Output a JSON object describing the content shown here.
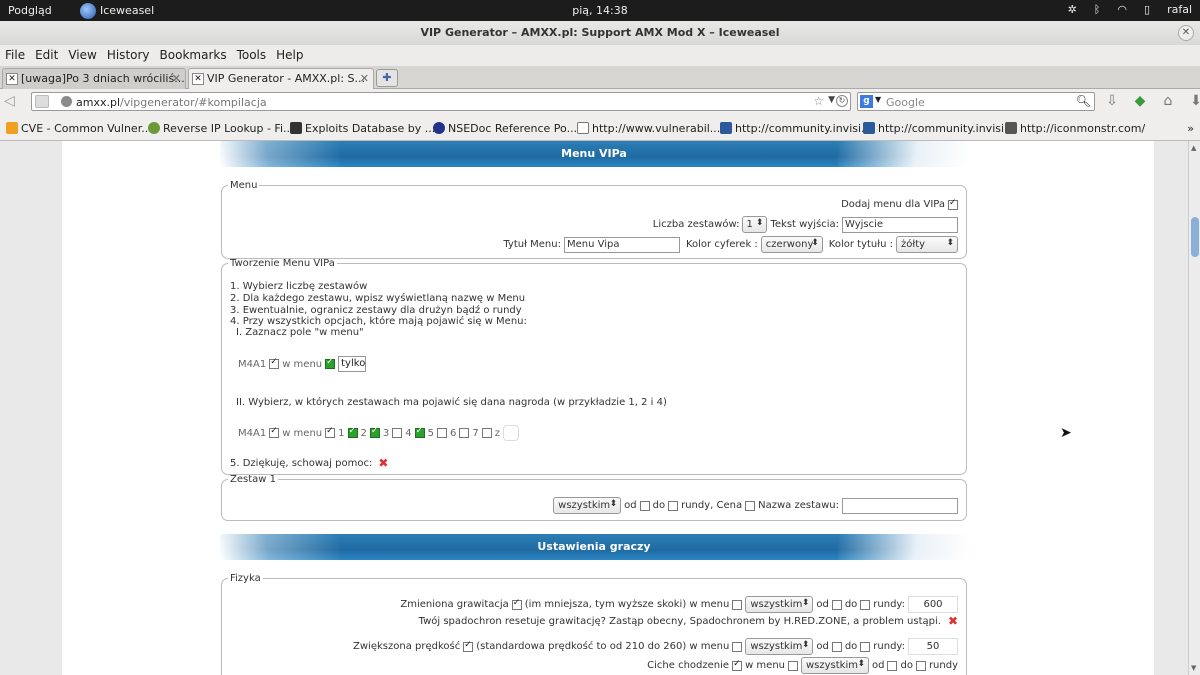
{
  "topbar": {
    "activities": "Podgląd",
    "app": "Iceweasel",
    "clock": "pią, 14:38",
    "user": "rafal"
  },
  "window": {
    "title": "VIP Generator – AMXX.pl: Support AMX Mod X – Iceweasel"
  },
  "menu": [
    "File",
    "Edit",
    "View",
    "History",
    "Bookmarks",
    "Tools",
    "Help"
  ],
  "tabs": [
    {
      "label": "[uwaga]Po 3 dniach wróciliś..."
    },
    {
      "label": "VIP Generator - AMXX.pl: S..."
    }
  ],
  "nav": {
    "url_host": "amxx.pl",
    "url_rest": "/vipgenerator/#kompilacja",
    "search_placeholder": "Google"
  },
  "bookmarks": [
    {
      "label": "CVE - Common Vulner...",
      "color": "#f0a020"
    },
    {
      "label": "Reverse IP Lookup - Fi...",
      "color": "#6a9a3a"
    },
    {
      "label": "Exploits Database by ...",
      "color": "#333333"
    },
    {
      "label": "NSEDoc Reference Po...",
      "color": "#223388"
    },
    {
      "label": "http://www.vulnerabil...",
      "color": "#ffffff"
    },
    {
      "label": "http://community.invisi...",
      "color": "#2a5a9a"
    },
    {
      "label": "http://community.invisi...",
      "color": "#2a5a9a"
    },
    {
      "label": "http://iconmonstr.com/",
      "color": "#555555"
    }
  ],
  "menu_vipa": {
    "header": "Menu VIPa",
    "menu_legend": "Menu",
    "add_menu_label": "Dodaj menu dla VIPa",
    "sets_count_label": "Liczba zestawów:",
    "sets_count_value": "1",
    "exit_text_label": "Tekst wyjścia:",
    "exit_text_value": "Wyjscie",
    "menu_title_label": "Tytuł Menu:",
    "menu_title_value": "Menu Vipa",
    "digit_color_label": "Kolor cyferek :",
    "digit_color_value": "czerwony",
    "title_color_label": "Kolor tytułu :",
    "title_color_value": "żółty"
  },
  "tworzenie": {
    "legend": "Tworzenie Menu VIPa",
    "steps": [
      "1. Wybierz liczbę zestawów",
      "2. Dla każdego zestawu, wpisz wyświetlaną nazwę w Menu",
      "3. Ewentualnie, ogranicz zestawy dla drużyn bądź o rundy",
      "4. Przy wszystkich opcjach, które mają pojawić się w Menu:"
    ],
    "sub1": "I. Zaznacz pole \"w menu\"",
    "example1_item": "M4A1",
    "example1_inmenu": "w menu",
    "example1_input": "tylko",
    "sub2": "II. Wybierz, w których zestawach ma pojawić się dana nagroda (w przykładzie 1, 2 i 4)",
    "example2_item": "M4A1",
    "example2_inmenu": "w menu",
    "example2_nums": [
      "1",
      "2",
      "3",
      "4",
      "5",
      "6",
      "7"
    ],
    "example2_z": "z",
    "thanks": "5. Dziękuję, schowaj pomoc:"
  },
  "zestaw1": {
    "legend": "Zestaw 1",
    "team_value": "wszystkim",
    "od": "od",
    "do": "do",
    "rundy": "rundy, Cena",
    "name_label": "Nazwa zestawu:"
  },
  "ustawienia": {
    "header": "Ustawienia graczy",
    "fizyka_legend": "Fizyka",
    "gravity_label": "Zmieniona grawitacja",
    "gravity_desc": "(im mniejsza, tym wyższe skoki) w menu",
    "gravity_value": "600",
    "gravity_note": "Twój spadochron resetuje grawitację? Zastąp obecny, Spadochronem by H.RED.ZONE, a problem ustąpi.",
    "speed_label": "Zwiększona prędkość",
    "speed_desc": "(standardowa prędkość to od 210 do 260) w menu",
    "speed_value": "50",
    "silent_label": "Ciche chodzenie",
    "w_menu": "w menu",
    "team_value": "wszystkim",
    "od": "od",
    "do": "do",
    "rundy_colon": "rundy:",
    "rundy": "rundy"
  }
}
